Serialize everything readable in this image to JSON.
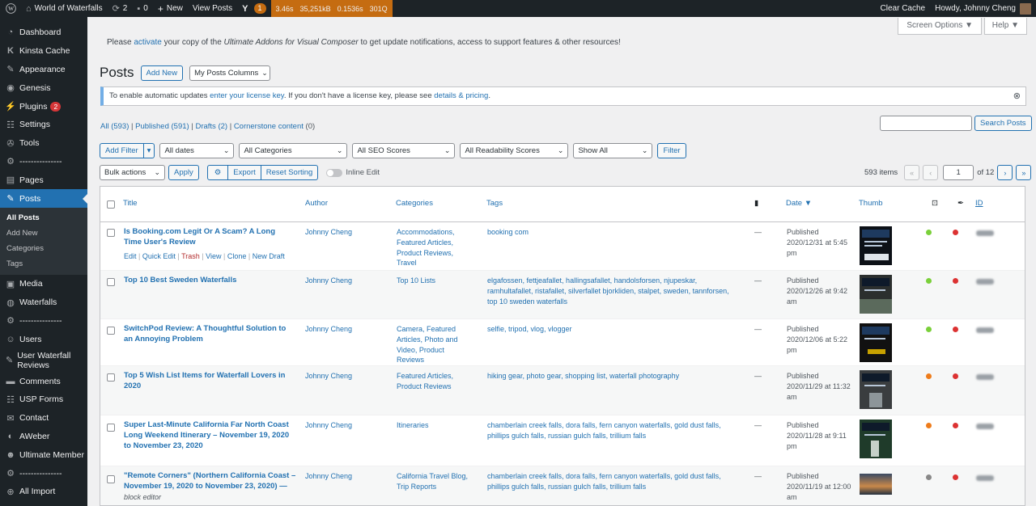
{
  "admin_bar": {
    "site_name": "World of Waterfalls",
    "updates_count": "2",
    "comments_count": "0",
    "new_label": "New",
    "view_posts_label": "View Posts",
    "yoast_count": "1",
    "qm_time": "3.46s",
    "qm_memory": "35,251kB",
    "qm_db_time": "0.1536s",
    "qm_queries": "301Q",
    "clear_cache_label": "Clear Cache",
    "howdy_label": "Howdy, Johnny Cheng",
    "icons": [
      "wordpress-icon",
      "home-icon",
      "updates-icon",
      "comments-icon",
      "plus-icon",
      "yoast-icon"
    ]
  },
  "sidebar": {
    "items": [
      {
        "label": "Dashboard",
        "icon": "dashboard-icon"
      },
      {
        "label": "Kinsta Cache",
        "icon": "kinsta-icon"
      },
      {
        "label": "Appearance",
        "icon": "appearance-icon"
      },
      {
        "label": "Genesis",
        "icon": "genesis-icon"
      },
      {
        "label": "Plugins",
        "icon": "plugins-icon",
        "badge": "2"
      },
      {
        "label": "Settings",
        "icon": "settings-icon"
      },
      {
        "label": "Tools",
        "icon": "tools-icon"
      },
      {
        "label": "---------------",
        "icon": "gear-icon"
      },
      {
        "label": "Pages",
        "icon": "pages-icon"
      },
      {
        "label": "Posts",
        "icon": "pin-icon"
      },
      {
        "label": "Media",
        "icon": "media-icon"
      },
      {
        "label": "Waterfalls",
        "icon": "waterfalls-icon"
      },
      {
        "label": "---------------",
        "icon": "gear-icon"
      },
      {
        "label": "Users",
        "icon": "users-icon"
      },
      {
        "label": "User Waterfall Reviews",
        "icon": "reviews-icon"
      },
      {
        "label": "Comments",
        "icon": "comments-icon"
      },
      {
        "label": "USP Forms",
        "icon": "forms-icon"
      },
      {
        "label": "Contact",
        "icon": "contact-icon"
      },
      {
        "label": "AWeber",
        "icon": "aweber-icon"
      },
      {
        "label": "Ultimate Member",
        "icon": "member-icon"
      },
      {
        "label": "---------------",
        "icon": "gear-icon"
      },
      {
        "label": "All Import",
        "icon": "import-icon"
      }
    ],
    "posts_submenu": [
      "All Posts",
      "Add New",
      "Categories",
      "Tags"
    ]
  },
  "screen_options_label": "Screen Options ▼",
  "help_label": "Help ▼",
  "ultimate_notice": {
    "prefix": "Please ",
    "link": "activate",
    "middle": " your copy of the ",
    "product": "Ultimate Addons for Visual Composer",
    "suffix": " to get update notifications, access to support features & other resources!"
  },
  "page": {
    "title": "Posts",
    "add_new_label": "Add New",
    "columns_select": "My Posts Columns"
  },
  "license_notice": {
    "prefix": "To enable automatic updates ",
    "link1": "enter your license key",
    "middle": ". If you don't have a license key, please see ",
    "link2": "details & pricing",
    "suffix": "."
  },
  "views": [
    {
      "label": "All",
      "count": "(593)"
    },
    {
      "label": "Published",
      "count": "(591)"
    },
    {
      "label": "Drafts",
      "count": "(2)"
    },
    {
      "label": "Cornerstone content",
      "count": "(0)"
    }
  ],
  "search_button": "Search Posts",
  "filters": {
    "add_filter": "Add Filter",
    "dates": "All dates",
    "categories": "All Categories",
    "seo": "All SEO Scores",
    "readability": "All Readability Scores",
    "show": "Show All",
    "filter_btn": "Filter"
  },
  "bulk": {
    "bulk_actions": "Bulk actions",
    "apply": "Apply",
    "export": "Export",
    "reset_sorting": "Reset Sorting",
    "inline_edit": "Inline Edit"
  },
  "pagination": {
    "items": "593 items",
    "current_page": "1",
    "of_pages": "of 12"
  },
  "table": {
    "columns": [
      "Title",
      "Author",
      "Categories",
      "Tags",
      "Date ▼",
      "Thumb",
      "ID"
    ],
    "rows": [
      {
        "title": "Is Booking.com Legit Or A Scam? A Long Time User's Review",
        "author": "Johnny Cheng",
        "categories": "Accommodations, Featured Articles, Product Reviews, Travel",
        "tags": "booking com",
        "comments": "—",
        "status": "Published",
        "date": "2020/12/31 at 5:45 pm",
        "seo": "#7ad03a",
        "readability": "#dc3232",
        "actions": {
          "edit": "Edit",
          "quick_edit": "Quick Edit",
          "trash": "Trash",
          "view": "View",
          "clone": "Clone",
          "new_draft": "New Draft"
        }
      },
      {
        "title": "Top 10 Best Sweden Waterfalls",
        "author": "Johnny Cheng",
        "categories": "Top 10 Lists",
        "tags": "elgafossen, fettjeafallet, hallingsafallet, handolsforsen, njupeskar, ramhultafallet, ristafallet, silverfallet bjorkliden, stalpet, sweden, tannforsen, top 10 sweden waterfalls",
        "comments": "—",
        "status": "Published",
        "date": "2020/12/26 at 9:42 am",
        "seo": "#7ad03a",
        "readability": "#dc3232"
      },
      {
        "title": "SwitchPod Review: A Thoughtful Solution to an Annoying Problem",
        "author": "Johnny Cheng",
        "categories": "Camera, Featured Articles, Photo and Video, Product Reviews",
        "tags": "selfie, tripod, vlog, vlogger",
        "comments": "—",
        "status": "Published",
        "date": "2020/12/06 at 5:22 pm",
        "seo": "#7ad03a",
        "readability": "#dc3232"
      },
      {
        "title": "Top 5 Wish List Items for Waterfall Lovers in 2020",
        "author": "Johnny Cheng",
        "categories": "Featured Articles, Product Reviews",
        "tags": "hiking gear, photo gear, shopping list, waterfall photography",
        "comments": "—",
        "status": "Published",
        "date": "2020/11/29 at 11:32 am",
        "seo": "#ee7c1b",
        "readability": "#dc3232"
      },
      {
        "title": "Super Last-Minute California Far North Coast Long Weekend Itinerary – November 19, 2020 to November 23, 2020",
        "author": "Johnny Cheng",
        "categories": "Itineraries",
        "tags": "chamberlain creek falls, dora falls, fern canyon waterfalls, gold dust falls, phillips gulch falls, russian gulch falls, trillium falls",
        "comments": "—",
        "status": "Published",
        "date": "2020/11/28 at 9:11 pm",
        "seo": "#ee7c1b",
        "readability": "#dc3232"
      },
      {
        "title": "\"Remote Corners\" (Northern California Coast – November 19, 2020 to November 23, 2020) —",
        "subtitle": "block editor",
        "author": "Johnny Cheng",
        "categories": "California Travel Blog, Trip Reports",
        "tags": "chamberlain creek falls, dora falls, fern canyon waterfalls, gold dust falls, phillips gulch falls, russian gulch falls, trillium falls",
        "comments": "—",
        "status": "Published",
        "date": "2020/11/19 at 12:00 am",
        "seo": "#888888",
        "readability": "#dc3232"
      }
    ]
  }
}
